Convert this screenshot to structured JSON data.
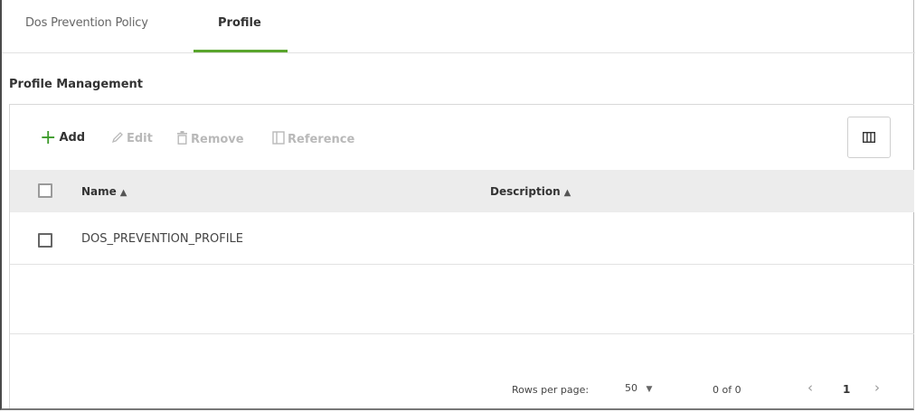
{
  "tabs": [
    {
      "label": "Dos Prevention Policy",
      "active": false
    },
    {
      "label": "Profile",
      "active": true
    }
  ],
  "section_title": "Profile Management",
  "toolbar": {
    "add": "Add",
    "edit": "Edit",
    "remove": "Remove",
    "reference": "Reference",
    "column_icon": "columns-icon"
  },
  "table": {
    "columns": [
      {
        "label": "Name",
        "sort_icon": "sort-icon"
      },
      {
        "label": "Description",
        "sort_icon": "sort-icon"
      }
    ],
    "rows": [
      {
        "name": "DOS_PREVENTION_PROFILE",
        "description": ""
      }
    ]
  },
  "pagination": {
    "rows_per_page_label": "Rows per page:",
    "rows_per_page_value": "50",
    "range": "0 of 0",
    "current_page": "1"
  },
  "colors": {
    "accent": "#5aa52d",
    "add_icon": "#3c9a2a",
    "disabled": "#b9b9b9",
    "header_bg": "#ececec"
  }
}
